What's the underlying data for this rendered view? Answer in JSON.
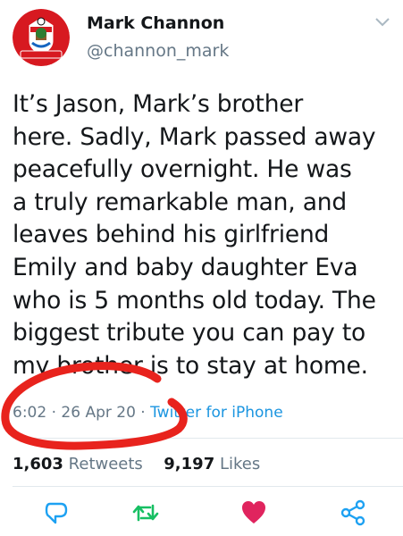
{
  "author": {
    "name": "Mark Channon",
    "handle": "@channon_mark",
    "avatar_icon": "southampton-fc-crest-icon",
    "avatar_crest_text": "SOUTHAMPTON FC"
  },
  "tweet": {
    "text": "It’s Jason, Mark’s brother\nhere. Sadly, Mark passed away\npeacefully overnight. He was\na truly remarkable man, and\nleaves behind his girlfriend\nEmily and baby daughter Eva\nwho is 5 months old today. The\nbiggest tribute you can pay to\nmy brother is to stay at home.",
    "time": "6:02",
    "date": "26 Apr 20",
    "source": "Twitter for iPhone"
  },
  "stats": {
    "retweets": "1,603",
    "retweets_label": "Retweets",
    "likes": "9,197",
    "likes_label": "Likes"
  },
  "actions": {
    "reply_icon": "reply-icon",
    "retweet_icon": "retweet-icon",
    "like_icon": "heart-icon",
    "share_icon": "share-icon"
  },
  "colors": {
    "text": "#14171a",
    "secondary": "#657786",
    "link": "#1b95e0",
    "retweet": "#17bf63",
    "like": "#e0245e",
    "annotation": "#e8231d"
  }
}
